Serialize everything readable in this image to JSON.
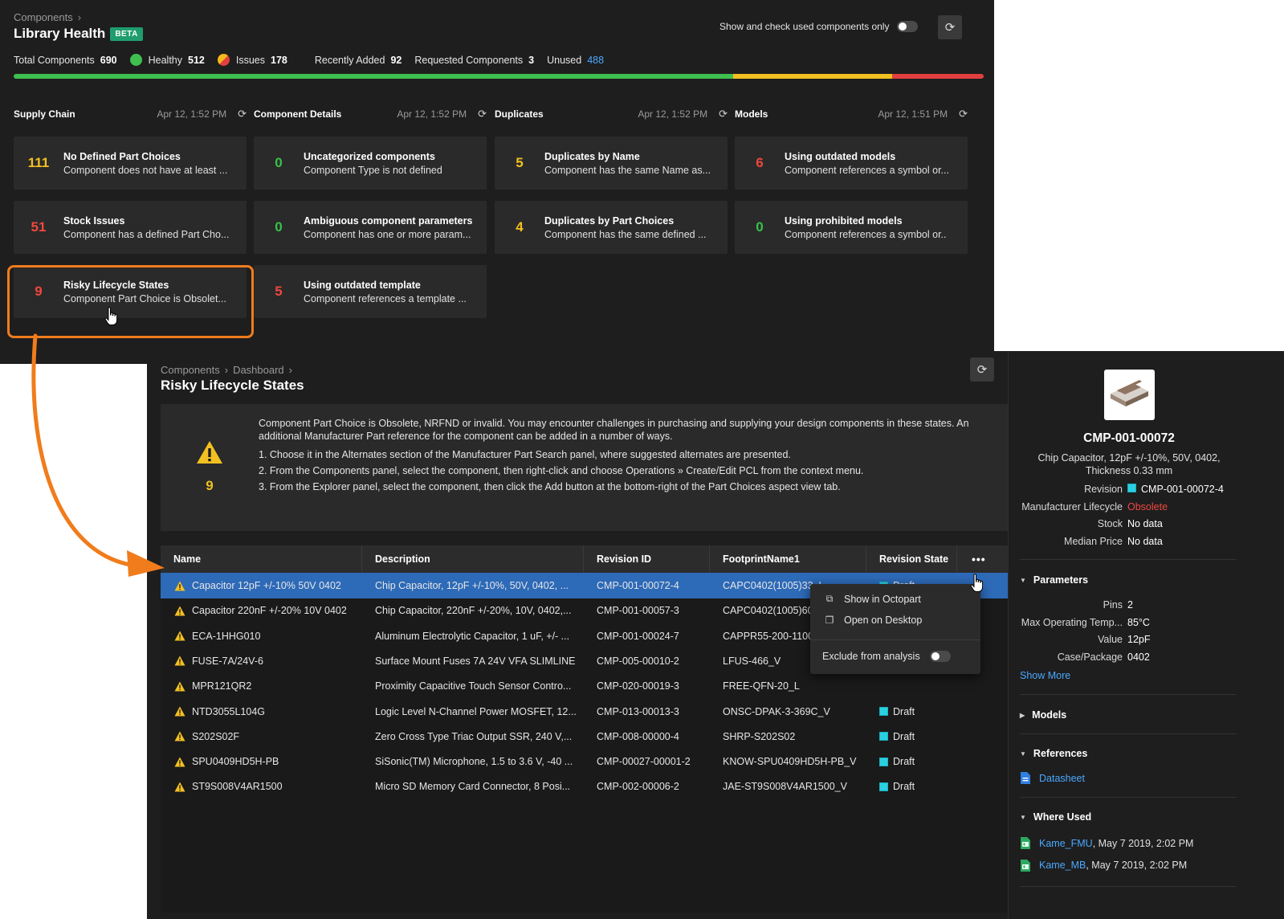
{
  "library_health": {
    "breadcrumb": "Components",
    "title": "Library Health",
    "beta": "BETA",
    "toggle_label": "Show and check used components only",
    "stats": {
      "total_label": "Total Components",
      "total": "690",
      "healthy_label": "Healthy",
      "healthy": "512",
      "issues_label": "Issues",
      "issues": "178",
      "recent_label": "Recently Added",
      "recent": "92",
      "requested_label": "Requested Components",
      "requested": "3",
      "unused_label": "Unused",
      "unused": "488"
    },
    "health_bar": {
      "healthy_fraction": 0.742,
      "issue_yellow_fraction": 0.164,
      "issue_red_fraction": 0.094,
      "colors": {
        "healthy": "#3fbf4f",
        "warning": "#f2c021",
        "error": "#e23f3f"
      }
    },
    "sections": [
      {
        "name": "Supply Chain",
        "date": "Apr 12, 1:52 PM"
      },
      {
        "name": "Component Details",
        "date": "Apr 12, 1:52 PM"
      },
      {
        "name": "Duplicates",
        "date": "Apr 12, 1:52 PM"
      },
      {
        "name": "Models",
        "date": "Apr 12, 1:51 PM"
      }
    ],
    "cards": [
      {
        "count": "111",
        "title": "No Defined Part Choices",
        "desc": "Component does not have at least ...",
        "color": "yellow"
      },
      {
        "count": "0",
        "title": "Uncategorized components",
        "desc": "Component Type is not defined",
        "color": "green"
      },
      {
        "count": "5",
        "title": "Duplicates by Name",
        "desc": "Component has the same Name as...",
        "color": "yellow"
      },
      {
        "count": "6",
        "title": "Using outdated models",
        "desc": "Component references a symbol or...",
        "color": "red"
      },
      {
        "count": "51",
        "title": "Stock Issues",
        "desc": "Component has a defined Part Cho...",
        "color": "red"
      },
      {
        "count": "0",
        "title": "Ambiguous component parameters",
        "desc": "Component has one or more param...",
        "color": "green"
      },
      {
        "count": "4",
        "title": "Duplicates by Part Choices",
        "desc": "Component has the same defined ...",
        "color": "yellow"
      },
      {
        "count": "0",
        "title": "Using prohibited models",
        "desc": "Component references a symbol or..",
        "color": "green"
      },
      {
        "count": "9",
        "title": "Risky Lifecycle States",
        "desc": "Component Part Choice is Obsolet...",
        "color": "red"
      },
      {
        "count": "5",
        "title": "Using outdated template",
        "desc": "Component references a template ...",
        "color": "red"
      }
    ]
  },
  "detail": {
    "breadcrumb": [
      "Components",
      "Dashboard"
    ],
    "title": "Risky Lifecycle States",
    "count": "9",
    "info": [
      "Component Part Choice is Obsolete, NRFND or invalid. You may encounter challenges in purchasing and supplying your design components in these states. An additional Manufacturer Part reference for the component can be added in a number of ways.",
      "1. Choose it in the Alternates section of the Manufacturer Part Search panel, where suggested alternates are presented.",
      "2. From the Components panel, select the component, then right-click and choose Operations » Create/Edit PCL from the context menu.",
      "3. From the Explorer panel, select the component, then click the Add button at the bottom-right of the Part Choices aspect view tab."
    ],
    "columns": [
      "Name",
      "Description",
      "Revision ID",
      "FootprintName1",
      "Revision State"
    ],
    "rows": [
      {
        "name": "Capacitor 12pF +/-10% 50V 0402",
        "desc": "Chip Capacitor, 12pF +/-10%, 50V, 0402, ...",
        "rev": "CMP-001-00072-4",
        "fp": "CAPC0402(1005)33_L",
        "state": "Draft"
      },
      {
        "name": "Capacitor 220nF +/-20% 10V 0402",
        "desc": "Chip Capacitor, 220nF +/-20%, 10V, 0402,...",
        "rev": "CMP-001-00057-3",
        "fp": "CAPC0402(1005)60",
        "state": ""
      },
      {
        "name": "ECA-1HHG010",
        "desc": "Aluminum Electrolytic Capacitor, 1 uF, +/- ...",
        "rev": "CMP-001-00024-7",
        "fp": "CAPPR55-200-1100",
        "state": ""
      },
      {
        "name": "FUSE-7A/24V-6",
        "desc": "Surface Mount Fuses 7A 24V VFA SLIMLINE",
        "rev": "CMP-005-00010-2",
        "fp": "LFUS-466_V",
        "state": ""
      },
      {
        "name": "MPR121QR2",
        "desc": "Proximity Capacitive Touch Sensor Contro...",
        "rev": "CMP-020-00019-3",
        "fp": "FREE-QFN-20_L",
        "state": ""
      },
      {
        "name": "NTD3055L104G",
        "desc": "Logic Level N-Channel Power MOSFET, 12...",
        "rev": "CMP-013-00013-3",
        "fp": "ONSC-DPAK-3-369C_V",
        "state": "Draft"
      },
      {
        "name": "S202S02F",
        "desc": "Zero Cross Type Triac Output SSR, 240 V,...",
        "rev": "CMP-008-00000-4",
        "fp": "SHRP-S202S02",
        "state": "Draft"
      },
      {
        "name": "SPU0409HD5H-PB",
        "desc": "SiSonic(TM) Microphone, 1.5 to 3.6 V, -40 ...",
        "rev": "CMP-00027-00001-2",
        "fp": "KNOW-SPU0409HD5H-PB_V",
        "state": "Draft"
      },
      {
        "name": "ST9S008V4AR1500",
        "desc": "Micro SD Memory Card Connector, 8 Posi...",
        "rev": "CMP-002-00006-2",
        "fp": "JAE-ST9S008V4AR1500_V",
        "state": "Draft"
      }
    ],
    "context_menu": {
      "show": "Show in Octopart",
      "open": "Open on Desktop",
      "exclude": "Exclude from analysis"
    }
  },
  "side": {
    "id": "CMP-001-00072",
    "desc": "Chip Capacitor, 12pF +/-10%, 50V, 0402, Thickness 0.33 mm",
    "revision_label": "Revision",
    "revision": "CMP-001-00072-4",
    "lifecycle_label": "Manufacturer Lifecycle",
    "lifecycle": "Obsolete",
    "stock_label": "Stock",
    "stock": "No data",
    "price_label": "Median Price",
    "price": "No data",
    "parameters_title": "Parameters",
    "params": [
      {
        "k": "Pins",
        "v": "2"
      },
      {
        "k": "Max Operating Temp...",
        "v": "85°C"
      },
      {
        "k": "Value",
        "v": "12pF"
      },
      {
        "k": "Case/Package",
        "v": "0402"
      }
    ],
    "show_more": "Show More",
    "models_title": "Models",
    "references_title": "References",
    "datasheet": "Datasheet",
    "where_used_title": "Where Used",
    "where_used": [
      {
        "name": "Kame_FMU",
        "date": ", May 7 2019, 2:02 PM"
      },
      {
        "name": "Kame_MB",
        "date": ", May 7 2019, 2:02 PM"
      }
    ]
  }
}
